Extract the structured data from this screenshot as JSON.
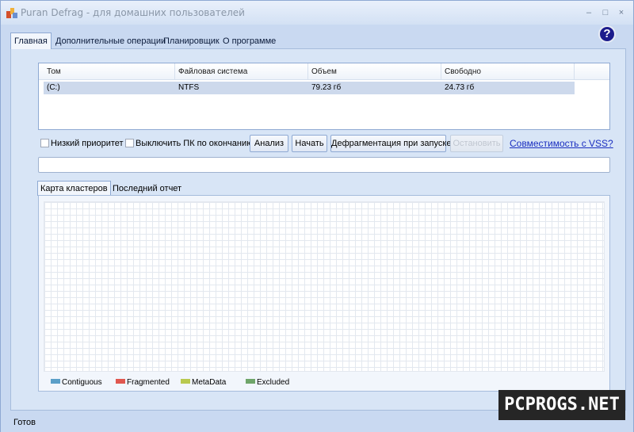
{
  "window": {
    "title": "Puran Defrag - для домашних пользователей",
    "controls": {
      "minimize": "–",
      "maximize": "□",
      "close": "×"
    },
    "help": "?"
  },
  "main_tabs": [
    {
      "label": "Главная",
      "active": true
    },
    {
      "label": "Дополнительные операции",
      "active": false
    },
    {
      "label": "Планировщик",
      "active": false
    },
    {
      "label": "О программе",
      "active": false
    }
  ],
  "volume_table": {
    "columns": [
      "Том",
      "Файловая система",
      "Объем",
      "Свободно"
    ],
    "rows": [
      {
        "volume": "(C:)",
        "fs": "NTFS",
        "size": "79.23 гб",
        "free": "24.73 гб"
      }
    ]
  },
  "options": {
    "low_priority": "Низкий приоритет",
    "shutdown_after": "Выключить ПК по окончанию"
  },
  "buttons": {
    "analyze": "Анализ",
    "start": "Начать",
    "boot_defrag": "Дефрагментация при запуске",
    "stop": "Остановить"
  },
  "vss_link": "Совместимость с VSS?",
  "sub_tabs": [
    {
      "label": "Карта кластеров",
      "active": true
    },
    {
      "label": "Последний отчет",
      "active": false
    }
  ],
  "legend": [
    {
      "label": "Contiguous",
      "color": "#5b9fc8"
    },
    {
      "label": "Fragmented",
      "color": "#e0574f"
    },
    {
      "label": "MetaData",
      "color": "#b9c94f"
    },
    {
      "label": "Excluded",
      "color": "#6fa56a"
    }
  ],
  "status": "Готов",
  "watermark": "PCPROGS.NET"
}
